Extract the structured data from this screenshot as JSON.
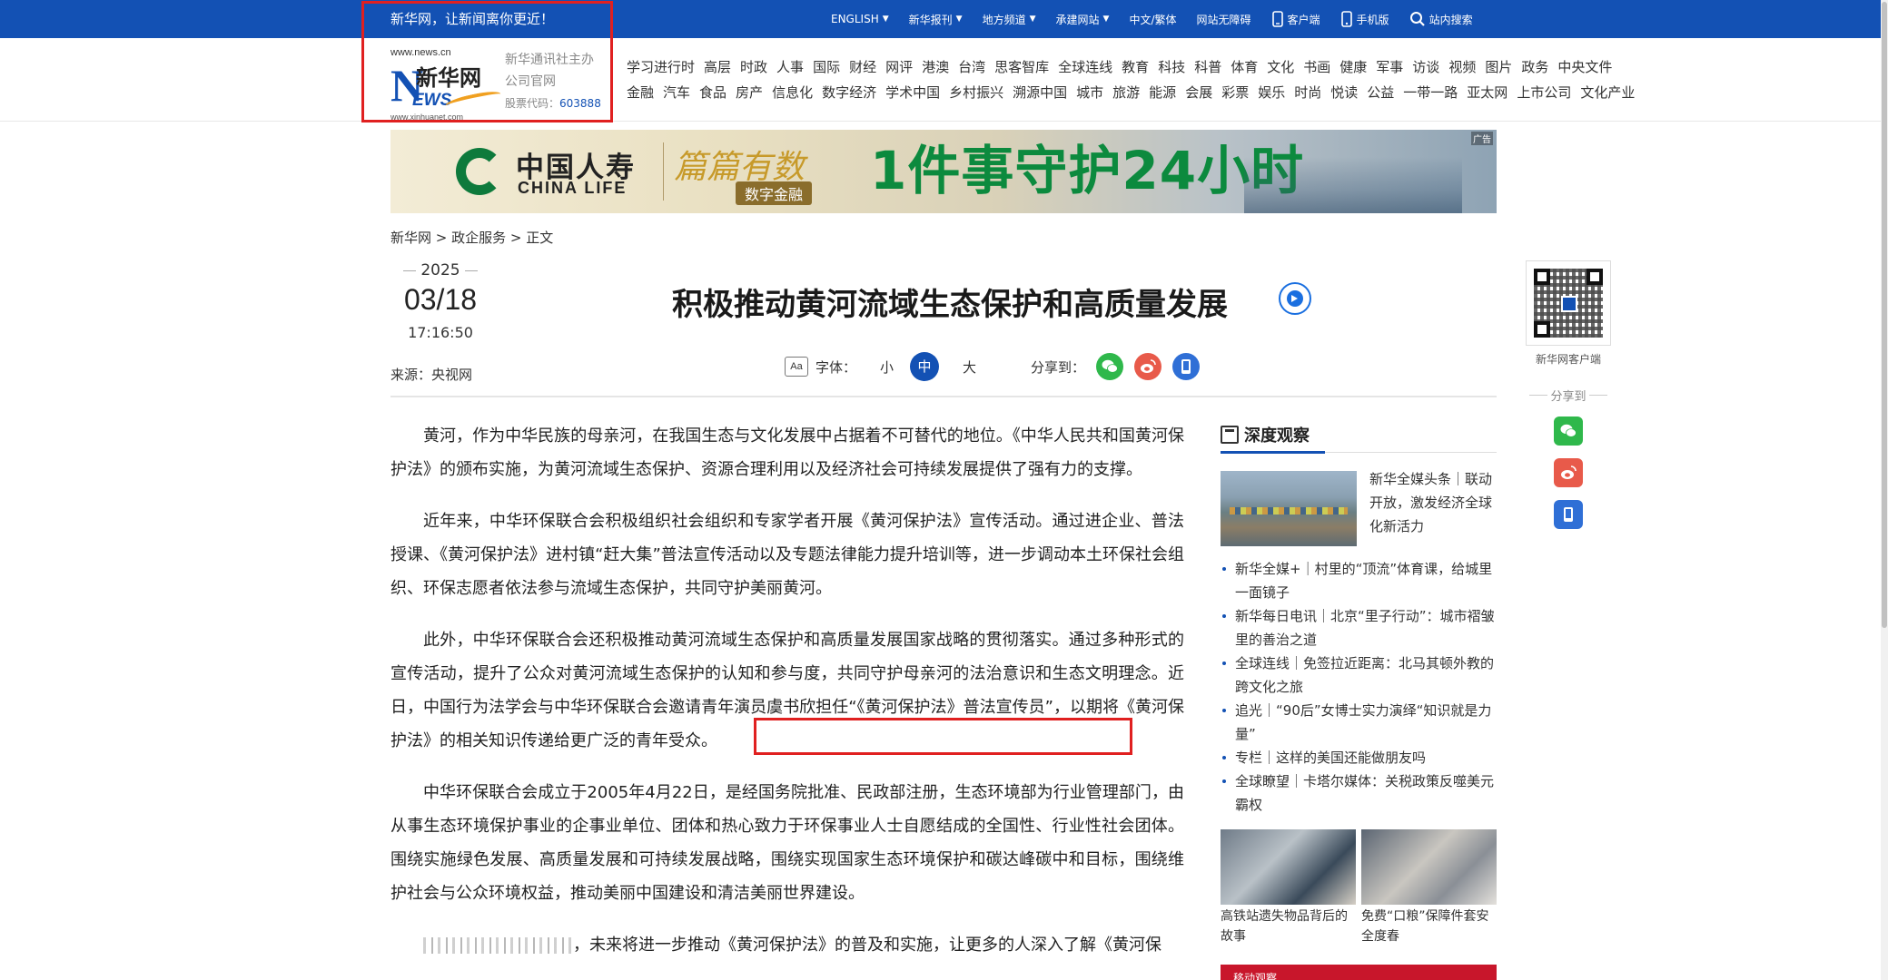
{
  "topbar": {
    "slogan": "新华网，让新闻离你更近！",
    "nav": [
      {
        "label": "ENGLISH",
        "dropdown": true
      },
      {
        "label": "新华报刊",
        "dropdown": true
      },
      {
        "label": "地方频道",
        "dropdown": true
      },
      {
        "label": "承建网站",
        "dropdown": true
      },
      {
        "label": "中文/繁体",
        "dropdown": false
      },
      {
        "label": "网站无障碍",
        "dropdown": false
      }
    ],
    "client_label": "客户端",
    "mobile_label": "手机版",
    "search_label": "站内搜索"
  },
  "logo": {
    "url_top": "www.news.cn",
    "n": "N",
    "cn": "新华网",
    "ews": "EWS",
    "url_bottom": "www.xinhuanet.com"
  },
  "company": {
    "line1": "新华通讯社主办",
    "line2": "公司官网",
    "code_label": "股票代码：",
    "code": "603888"
  },
  "channels": {
    "row1": [
      "学习进行时",
      "高层",
      "时政",
      "人事",
      "国际",
      "财经",
      "网评",
      "港澳",
      "台湾",
      "思客智库",
      "全球连线",
      "教育",
      "科技",
      "科普",
      "体育",
      "文化",
      "书画",
      "健康",
      "军事",
      "访谈",
      "视频",
      "图片",
      "政务",
      "中央文件"
    ],
    "row2": [
      "金融",
      "汽车",
      "食品",
      "房产",
      "信息化",
      "数字经济",
      "学术中国",
      "乡村振兴",
      "溯源中国",
      "城市",
      "旅游",
      "能源",
      "会展",
      "彩票",
      "娱乐",
      "时尚",
      "悦读",
      "公益",
      "一带一路",
      "亚太网",
      "上市公司",
      "文化产业"
    ]
  },
  "banner": {
    "brand_cn": "中国人寿",
    "brand_en": "CHINA LIFE",
    "script": "篇篇有数",
    "tag": "数字金融",
    "slogan": "1件事守护24小时",
    "ad": "广告"
  },
  "breadcrumb": {
    "home": "新华网",
    "sep": " > ",
    "section": "政企服务",
    "current": "正文"
  },
  "date": {
    "year": "2025",
    "month_day": "03/18",
    "time": "17:16:50"
  },
  "source": "来源：央视网",
  "article": {
    "title": "积极推动黄河流域生态保护和高质量发展",
    "font_label": "字体：",
    "font_small": "小",
    "font_medium": "中",
    "font_large": "大",
    "share_label": "分享到：",
    "paragraphs": [
      "黄河，作为中华民族的母亲河，在我国生态与文化发展中占据着不可替代的地位。《中华人民共和国黄河保护法》的颁布实施，为黄河流域生态保护、资源合理利用以及经济社会可持续发展提供了强有力的支撑。",
      "近年来，中华环保联合会积极组织社会组织和专家学者开展《黄河保护法》宣传活动。通过进企业、普法授课、《黄河保护法》进村镇“赶大集”普法宣传活动以及专题法律能力提升培训等，进一步调动本土环保社会组织、环保志愿者依法参与流域生态保护，共同守护美丽黄河。",
      "此外，中华环保联合会还积极推动黄河流域生态保护和高质量发展国家战略的贯彻落实。通过多种形式的宣传活动，提升了公众对黄河流域生态保护的认知和参与度，共同守护母亲河的法治意识和生态文明理念。近日，中国行为法学会与中华环保联合会邀请青年演员虞书欣担任“《黄河保护法》普法宣传员”，以期将《黄河保护法》的相关知识传递给更广泛的青年受众。",
      "中华环保联合会成立于2005年4月22日，是经国务院批准、民政部注册，生态环境部为行业管理部门，由从事生态环境保护事业的企事业单位、团体和热心致力于环保事业人士自愿结成的全国性、行业性社会团体。围绕实施绿色发展、高质量发展和可持续发展战略，围绕实现国家生态环境保护和碳达峰碳中和目标，围绕维护社会与公众环境权益，推动美丽中国建设和清洁美丽世界建设。"
    ],
    "last_line": "，未来将进一步推动《黄河保护法》的普及和实施，让更多的人深入了解《黄河保"
  },
  "sidebar": {
    "head": "深度观察",
    "feature_text": "新华全媒头条｜联动开放，激发经济全球化新活力",
    "items": [
      "新华全媒+｜村里的“顶流”体育课，给城里一面镜子",
      "新华每日电讯｜北京“里子行动”：城市褶皱里的善治之道",
      "全球连线｜免签拉近距离：北马其顿外教的跨文化之旅",
      "追光｜“90后”女博士实力演绎“知识就是力量”",
      "专栏｜这样的美国还能做朋友吗",
      "全球瞭望｜卡塔尔媒体：关税政策反噬美元霸权"
    ],
    "pics": [
      {
        "caption": "高铁站遗失物品背后的故事"
      },
      {
        "caption": "免费“口粮”保障件套安全度春"
      }
    ],
    "redbar": "移动观察"
  },
  "float": {
    "qr_caption": "新华网客户端",
    "share_label": "分享到"
  },
  "colors": {
    "brand_blue": "#1351b4",
    "highlight_red": "#e02020"
  }
}
